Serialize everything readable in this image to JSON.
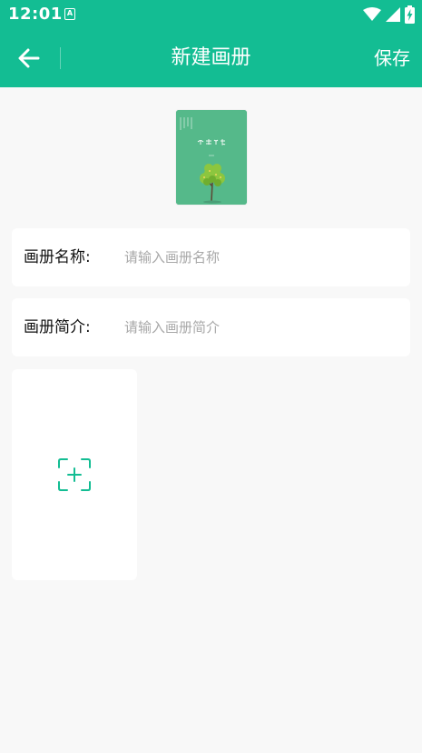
{
  "status_bar": {
    "time": "12:01",
    "notification_icon": "a-icon",
    "icons": [
      "wifi-icon",
      "signal-icon",
      "battery-charging-icon"
    ]
  },
  "app_bar": {
    "back_icon": "arrow-left-icon",
    "title": "新建画册",
    "save_label": "保存"
  },
  "cover": {
    "title_text": "光影相册"
  },
  "form": {
    "name": {
      "label": "画册名称:",
      "placeholder": "请输入画册名称",
      "value": ""
    },
    "intro": {
      "label": "画册简介:",
      "placeholder": "请输入画册简介",
      "value": ""
    }
  },
  "add_photo": {
    "icon": "add-image-scan-icon"
  },
  "colors": {
    "primary": "#13bd93",
    "background": "#f8f8f8",
    "card": "#ffffff",
    "placeholder": "#a8a8a8"
  }
}
